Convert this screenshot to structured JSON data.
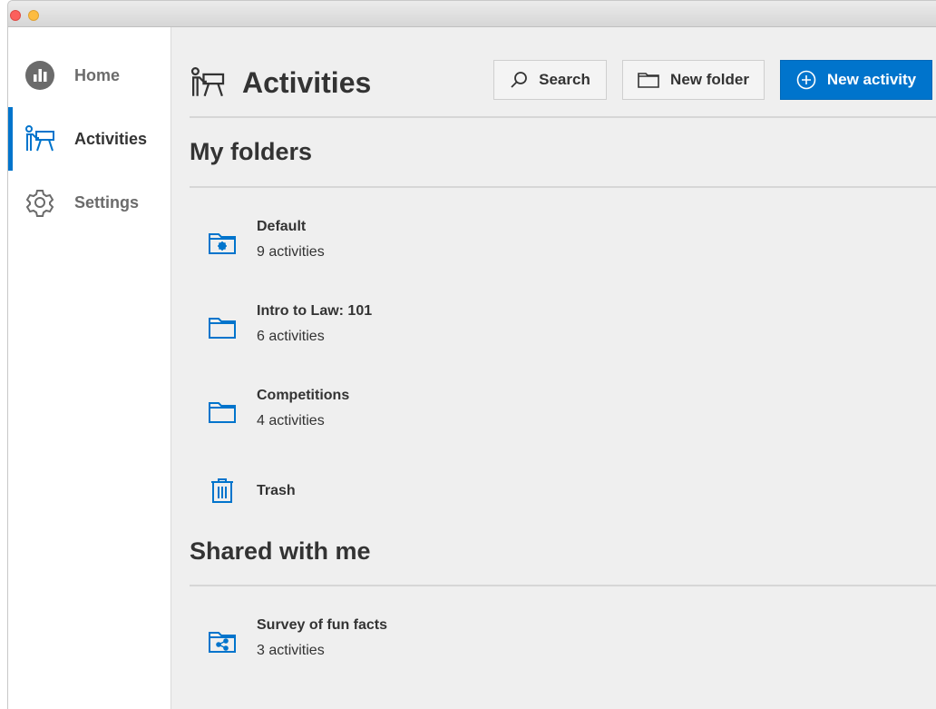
{
  "sidebar": {
    "items": [
      {
        "label": "Home",
        "icon": "home-chart-icon"
      },
      {
        "label": "Activities",
        "icon": "presenter-icon",
        "active": true
      },
      {
        "label": "Settings",
        "icon": "gear-icon"
      }
    ]
  },
  "header": {
    "title": "Activities",
    "icon": "presenter-icon",
    "search_label": "Search",
    "new_folder_label": "New folder",
    "new_activity_label": "New activity"
  },
  "my_folders": {
    "title": "My folders",
    "items": [
      {
        "name": "Default",
        "count": "9 activities",
        "icon": "settings-folder-icon"
      },
      {
        "name": "Intro to Law: 101",
        "count": "6 activities",
        "icon": "folder-icon"
      },
      {
        "name": "Competitions",
        "count": "4 activities",
        "icon": "folder-icon"
      },
      {
        "name": "Trash",
        "icon": "trash-icon"
      }
    ]
  },
  "shared": {
    "title": "Shared with me",
    "items": [
      {
        "name": "Survey of fun facts",
        "count": "3 activities",
        "icon": "shared-folder-icon"
      }
    ]
  },
  "colors": {
    "accent": "#0074cc",
    "text": "#333333",
    "muted": "#6b6b6b",
    "background": "#efefef"
  }
}
